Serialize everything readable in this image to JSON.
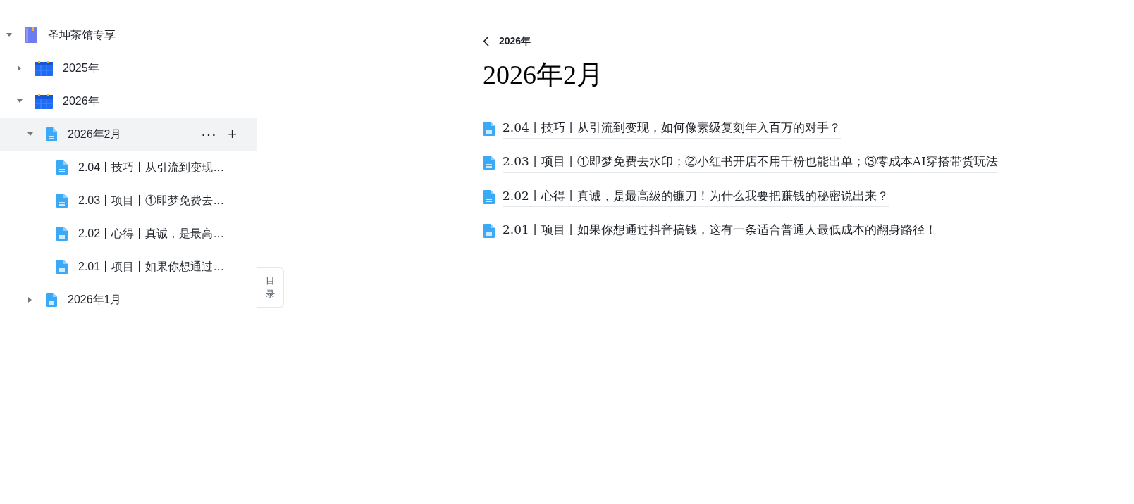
{
  "sidebar": {
    "tree": [
      {
        "label": "圣坤茶馆专享",
        "kind": "book",
        "expanded": true,
        "selected": false,
        "children": [
          {
            "label": "2025年",
            "kind": "calendar",
            "expanded": false,
            "selected": false
          },
          {
            "label": "2026年",
            "kind": "calendar",
            "expanded": true,
            "selected": false,
            "children": [
              {
                "label": "2026年2月",
                "kind": "doc",
                "expanded": true,
                "selected": true,
                "actions": [
                  "⋯",
                  "+"
                ],
                "children": [
                  {
                    "label": "2.04丨技巧丨从引流到变现…",
                    "kind": "doc",
                    "selected": false
                  },
                  {
                    "label": "2.03丨项目丨①即梦免费去…",
                    "kind": "doc",
                    "selected": false
                  },
                  {
                    "label": "2.02丨心得丨真诚，是最高…",
                    "kind": "doc",
                    "selected": false
                  },
                  {
                    "label": "2.01丨项目丨如果你想通过…",
                    "kind": "doc",
                    "selected": false
                  }
                ]
              },
              {
                "label": "2026年1月",
                "kind": "doc",
                "expanded": false,
                "selected": false
              }
            ]
          }
        ]
      }
    ]
  },
  "toc_tab": {
    "label": "目录"
  },
  "main": {
    "breadcrumb": "2026年",
    "title": "2026年2月",
    "documents": [
      {
        "title": "2.04丨技巧丨从引流到变现，如何像素级复刻年入百万的对手？"
      },
      {
        "title": "2.03丨项目丨①即梦免费去水印；②小红书开店不用千粉也能出单；③零成本AI穿搭带货玩法"
      },
      {
        "title": "2.02丨心得丨真诚，是最高级的镰刀！为什么我要把赚钱的秘密说出来？"
      },
      {
        "title": "2.01丨项目丨如果你想通过抖音搞钱，这有一条适合普通人最低成本的翻身路径！"
      }
    ]
  }
}
